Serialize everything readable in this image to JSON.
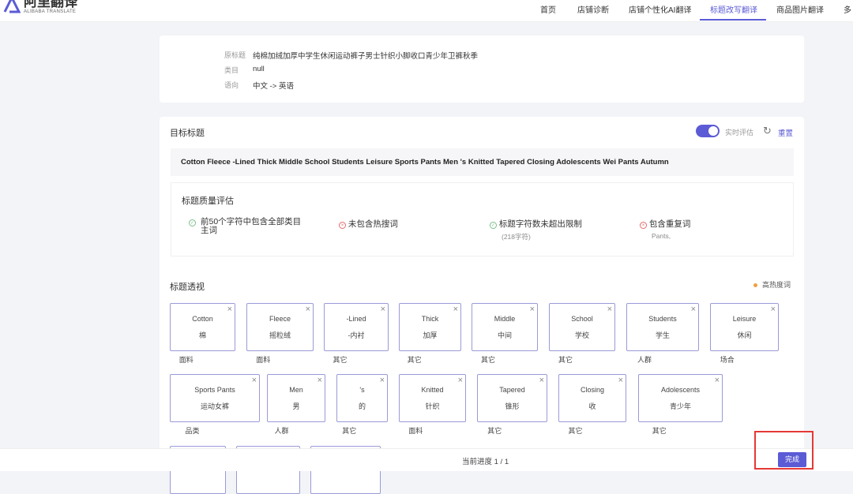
{
  "header": {
    "logo_cn": "阿里翻译",
    "logo_en": "ALIBABA TRANSLATE",
    "nav": [
      "首页",
      "店铺诊断",
      "店铺个性化AI翻译",
      "标题改写翻译",
      "商品图片翻译",
      "多"
    ],
    "active": 3
  },
  "info": {
    "rows": [
      {
        "label": "原标题",
        "value": "纯棉加绒加厚中学生休闲运动裤子男士针织小脚收口青少年卫裤秋季"
      },
      {
        "label": "类目",
        "value": "null"
      },
      {
        "label": "语向",
        "value": "中文 -> 英语"
      }
    ]
  },
  "target": {
    "title": "目标标题",
    "toggle_label": "实时评估",
    "toggle_on": true,
    "reset": "重置",
    "text": "Cotton Fleece -Lined Thick Middle School Students Leisure Sports Pants Men 's Knitted Tapered Closing Adolescents Wei Pants Autumn"
  },
  "quality": {
    "title": "标题质量评估",
    "items": [
      {
        "ok": true,
        "text": "前50个字符中包含全部类目主词",
        "sub": ""
      },
      {
        "ok": false,
        "text": "未包含热搜词",
        "sub": ""
      },
      {
        "ok": true,
        "text": "标题字符数未超出限制",
        "sub": "(218字符)"
      },
      {
        "ok": false,
        "text": "包含重复词",
        "sub": "Pants,"
      }
    ]
  },
  "perspective": {
    "title": "标题透视",
    "legend": "高热度词",
    "tags": [
      {
        "en": "Cotton",
        "zh": "棉",
        "cat": "面料"
      },
      {
        "en": "Fleece",
        "zh": "摇粒绒",
        "cat": "面料"
      },
      {
        "en": "-Lined",
        "zh": "-内衬",
        "cat": "其它"
      },
      {
        "en": "Thick",
        "zh": "加厚",
        "cat": "其它"
      },
      {
        "en": "Middle",
        "zh": "中间",
        "cat": "其它"
      },
      {
        "en": "School",
        "zh": "学校",
        "cat": "其它"
      },
      {
        "en": "Students",
        "zh": "学生",
        "cat": "人群"
      },
      {
        "en": "Leisure",
        "zh": "休闲",
        "cat": "场合"
      },
      {
        "en": "Sports Pants",
        "zh": "运动女裤",
        "cat": "品类"
      },
      {
        "en": "Men",
        "zh": "男",
        "cat": "人群"
      },
      {
        "en": "'s",
        "zh": "的",
        "cat": "其它"
      },
      {
        "en": "Knitted",
        "zh": "针织",
        "cat": "面料"
      },
      {
        "en": "Tapered",
        "zh": "锥形",
        "cat": "其它"
      },
      {
        "en": "Closing",
        "zh": "收",
        "cat": "其它"
      },
      {
        "en": "Adolescents",
        "zh": "青少年",
        "cat": "其它"
      }
    ]
  },
  "footer": {
    "progress": "当前进度 1 / 1",
    "done": "完成"
  },
  "colors": {
    "accent": "#5b5bd6",
    "ok": "#7cc08a",
    "bad": "#e86a6a",
    "hot": "#f0a040",
    "highlight": "#e53935"
  }
}
